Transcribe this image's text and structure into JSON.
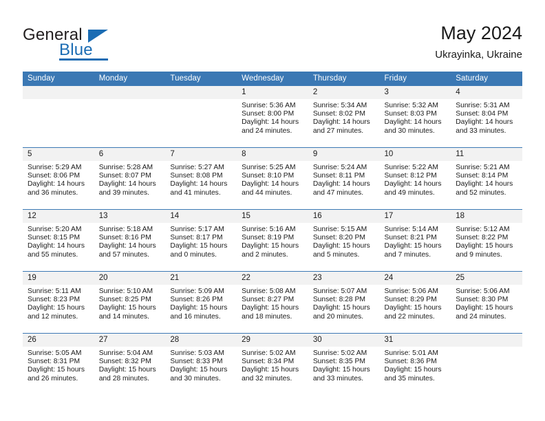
{
  "brand": {
    "line1": "General",
    "line2": "Blue",
    "logo_icon": "blue-triangle-icon"
  },
  "header": {
    "title": "May 2024",
    "subtitle": "Ukrayinka, Ukraine"
  },
  "columns": [
    "Sunday",
    "Monday",
    "Tuesday",
    "Wednesday",
    "Thursday",
    "Friday",
    "Saturday"
  ],
  "colors": {
    "header_blue": "#3b78b4",
    "brand_blue": "#1b6cb3",
    "daynum_bg": "#f2f2f2",
    "text": "#1a1a1a"
  },
  "labels": {
    "sunrise_prefix": "Sunrise: ",
    "sunset_prefix": "Sunset: ",
    "daylight_prefix": "Daylight: "
  },
  "weeks": [
    [
      {
        "day": "",
        "empty": true
      },
      {
        "day": "",
        "empty": true
      },
      {
        "day": "",
        "empty": true
      },
      {
        "day": "1",
        "sunrise": "Sunrise: 5:36 AM",
        "sunset": "Sunset: 8:00 PM",
        "daylight_1": "Daylight: 14 hours",
        "daylight_2": "and 24 minutes."
      },
      {
        "day": "2",
        "sunrise": "Sunrise: 5:34 AM",
        "sunset": "Sunset: 8:02 PM",
        "daylight_1": "Daylight: 14 hours",
        "daylight_2": "and 27 minutes."
      },
      {
        "day": "3",
        "sunrise": "Sunrise: 5:32 AM",
        "sunset": "Sunset: 8:03 PM",
        "daylight_1": "Daylight: 14 hours",
        "daylight_2": "and 30 minutes."
      },
      {
        "day": "4",
        "sunrise": "Sunrise: 5:31 AM",
        "sunset": "Sunset: 8:04 PM",
        "daylight_1": "Daylight: 14 hours",
        "daylight_2": "and 33 minutes."
      }
    ],
    [
      {
        "day": "5",
        "sunrise": "Sunrise: 5:29 AM",
        "sunset": "Sunset: 8:06 PM",
        "daylight_1": "Daylight: 14 hours",
        "daylight_2": "and 36 minutes."
      },
      {
        "day": "6",
        "sunrise": "Sunrise: 5:28 AM",
        "sunset": "Sunset: 8:07 PM",
        "daylight_1": "Daylight: 14 hours",
        "daylight_2": "and 39 minutes."
      },
      {
        "day": "7",
        "sunrise": "Sunrise: 5:27 AM",
        "sunset": "Sunset: 8:08 PM",
        "daylight_1": "Daylight: 14 hours",
        "daylight_2": "and 41 minutes."
      },
      {
        "day": "8",
        "sunrise": "Sunrise: 5:25 AM",
        "sunset": "Sunset: 8:10 PM",
        "daylight_1": "Daylight: 14 hours",
        "daylight_2": "and 44 minutes."
      },
      {
        "day": "9",
        "sunrise": "Sunrise: 5:24 AM",
        "sunset": "Sunset: 8:11 PM",
        "daylight_1": "Daylight: 14 hours",
        "daylight_2": "and 47 minutes."
      },
      {
        "day": "10",
        "sunrise": "Sunrise: 5:22 AM",
        "sunset": "Sunset: 8:12 PM",
        "daylight_1": "Daylight: 14 hours",
        "daylight_2": "and 49 minutes."
      },
      {
        "day": "11",
        "sunrise": "Sunrise: 5:21 AM",
        "sunset": "Sunset: 8:14 PM",
        "daylight_1": "Daylight: 14 hours",
        "daylight_2": "and 52 minutes."
      }
    ],
    [
      {
        "day": "12",
        "sunrise": "Sunrise: 5:20 AM",
        "sunset": "Sunset: 8:15 PM",
        "daylight_1": "Daylight: 14 hours",
        "daylight_2": "and 55 minutes."
      },
      {
        "day": "13",
        "sunrise": "Sunrise: 5:18 AM",
        "sunset": "Sunset: 8:16 PM",
        "daylight_1": "Daylight: 14 hours",
        "daylight_2": "and 57 minutes."
      },
      {
        "day": "14",
        "sunrise": "Sunrise: 5:17 AM",
        "sunset": "Sunset: 8:17 PM",
        "daylight_1": "Daylight: 15 hours",
        "daylight_2": "and 0 minutes."
      },
      {
        "day": "15",
        "sunrise": "Sunrise: 5:16 AM",
        "sunset": "Sunset: 8:19 PM",
        "daylight_1": "Daylight: 15 hours",
        "daylight_2": "and 2 minutes."
      },
      {
        "day": "16",
        "sunrise": "Sunrise: 5:15 AM",
        "sunset": "Sunset: 8:20 PM",
        "daylight_1": "Daylight: 15 hours",
        "daylight_2": "and 5 minutes."
      },
      {
        "day": "17",
        "sunrise": "Sunrise: 5:14 AM",
        "sunset": "Sunset: 8:21 PM",
        "daylight_1": "Daylight: 15 hours",
        "daylight_2": "and 7 minutes."
      },
      {
        "day": "18",
        "sunrise": "Sunrise: 5:12 AM",
        "sunset": "Sunset: 8:22 PM",
        "daylight_1": "Daylight: 15 hours",
        "daylight_2": "and 9 minutes."
      }
    ],
    [
      {
        "day": "19",
        "sunrise": "Sunrise: 5:11 AM",
        "sunset": "Sunset: 8:23 PM",
        "daylight_1": "Daylight: 15 hours",
        "daylight_2": "and 12 minutes."
      },
      {
        "day": "20",
        "sunrise": "Sunrise: 5:10 AM",
        "sunset": "Sunset: 8:25 PM",
        "daylight_1": "Daylight: 15 hours",
        "daylight_2": "and 14 minutes."
      },
      {
        "day": "21",
        "sunrise": "Sunrise: 5:09 AM",
        "sunset": "Sunset: 8:26 PM",
        "daylight_1": "Daylight: 15 hours",
        "daylight_2": "and 16 minutes."
      },
      {
        "day": "22",
        "sunrise": "Sunrise: 5:08 AM",
        "sunset": "Sunset: 8:27 PM",
        "daylight_1": "Daylight: 15 hours",
        "daylight_2": "and 18 minutes."
      },
      {
        "day": "23",
        "sunrise": "Sunrise: 5:07 AM",
        "sunset": "Sunset: 8:28 PM",
        "daylight_1": "Daylight: 15 hours",
        "daylight_2": "and 20 minutes."
      },
      {
        "day": "24",
        "sunrise": "Sunrise: 5:06 AM",
        "sunset": "Sunset: 8:29 PM",
        "daylight_1": "Daylight: 15 hours",
        "daylight_2": "and 22 minutes."
      },
      {
        "day": "25",
        "sunrise": "Sunrise: 5:06 AM",
        "sunset": "Sunset: 8:30 PM",
        "daylight_1": "Daylight: 15 hours",
        "daylight_2": "and 24 minutes."
      }
    ],
    [
      {
        "day": "26",
        "sunrise": "Sunrise: 5:05 AM",
        "sunset": "Sunset: 8:31 PM",
        "daylight_1": "Daylight: 15 hours",
        "daylight_2": "and 26 minutes."
      },
      {
        "day": "27",
        "sunrise": "Sunrise: 5:04 AM",
        "sunset": "Sunset: 8:32 PM",
        "daylight_1": "Daylight: 15 hours",
        "daylight_2": "and 28 minutes."
      },
      {
        "day": "28",
        "sunrise": "Sunrise: 5:03 AM",
        "sunset": "Sunset: 8:33 PM",
        "daylight_1": "Daylight: 15 hours",
        "daylight_2": "and 30 minutes."
      },
      {
        "day": "29",
        "sunrise": "Sunrise: 5:02 AM",
        "sunset": "Sunset: 8:34 PM",
        "daylight_1": "Daylight: 15 hours",
        "daylight_2": "and 32 minutes."
      },
      {
        "day": "30",
        "sunrise": "Sunrise: 5:02 AM",
        "sunset": "Sunset: 8:35 PM",
        "daylight_1": "Daylight: 15 hours",
        "daylight_2": "and 33 minutes."
      },
      {
        "day": "31",
        "sunrise": "Sunrise: 5:01 AM",
        "sunset": "Sunset: 8:36 PM",
        "daylight_1": "Daylight: 15 hours",
        "daylight_2": "and 35 minutes."
      },
      {
        "day": "",
        "empty": true,
        "trailing": true
      }
    ]
  ]
}
